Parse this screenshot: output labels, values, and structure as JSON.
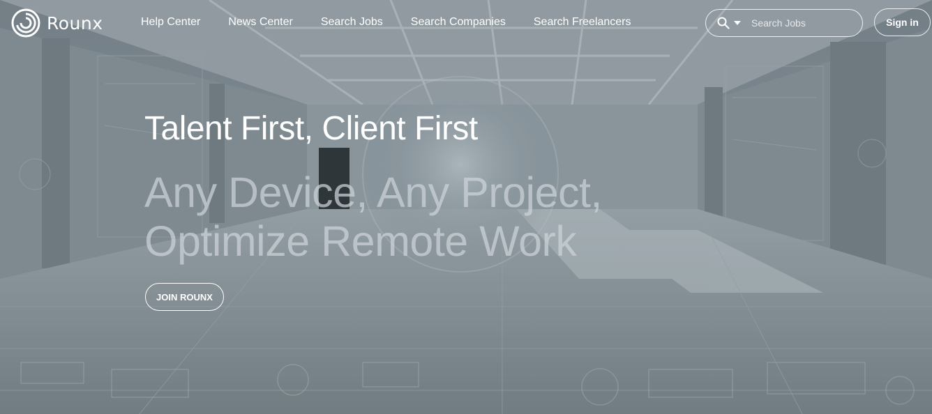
{
  "brand": {
    "name": "Rounx"
  },
  "nav": {
    "items": [
      {
        "label": "Help Center"
      },
      {
        "label": "News Center"
      },
      {
        "label": "Search Jobs"
      },
      {
        "label": "Search Companies"
      },
      {
        "label": "Search Freelancers"
      }
    ]
  },
  "search": {
    "placeholder": "Search Jobs",
    "icon": "search-icon"
  },
  "auth": {
    "signin_label": "Sign in"
  },
  "hero": {
    "headline": "Talent First, Client First",
    "subhead_line1": "Any Device, Any Project,",
    "subhead_line2": "Optimize Remote Work",
    "cta_label": "JOIN ROUNX"
  },
  "colors": {
    "text": "#ffffff",
    "background_tint": "#8a969e"
  }
}
